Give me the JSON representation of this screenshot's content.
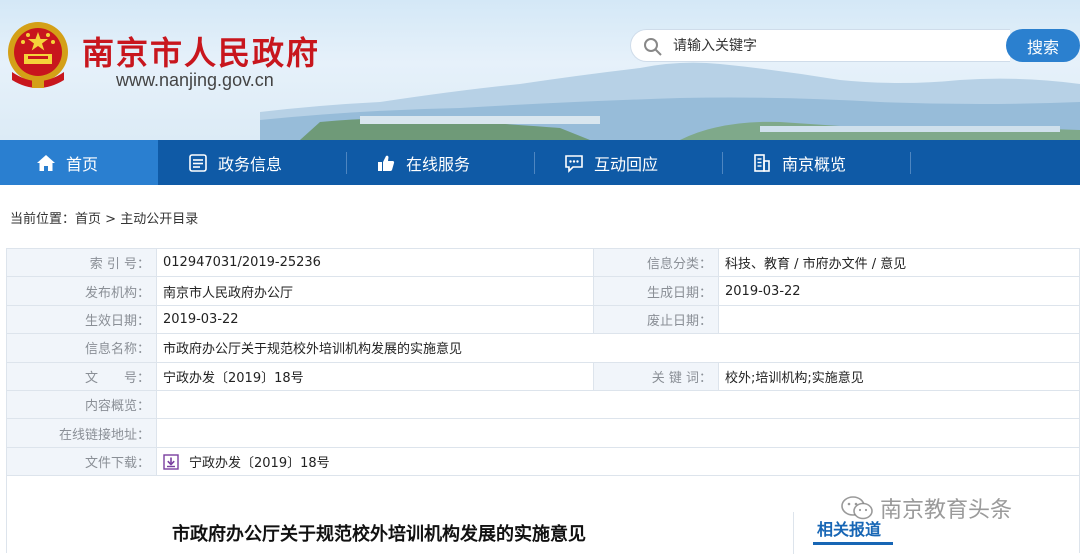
{
  "header": {
    "site_title": "南京市人民政府",
    "site_url": "www.nanjing.gov.cn",
    "search_placeholder": "请输入关键字",
    "search_button": "搜索"
  },
  "nav": {
    "items": [
      {
        "label": "首页",
        "icon": "home-icon"
      },
      {
        "label": "政务信息",
        "icon": "list-icon"
      },
      {
        "label": "在线服务",
        "icon": "thumbs-up-icon"
      },
      {
        "label": "互动回应",
        "icon": "chat-icon"
      },
      {
        "label": "南京概览",
        "icon": "building-icon"
      }
    ]
  },
  "breadcrumb": {
    "prefix": "当前位置：",
    "home": "首页",
    "sep": " > ",
    "current": "主动公开目录"
  },
  "info": {
    "index_label": "索 引 号：",
    "index_value": "012947031/2019-25236",
    "category_label": "信息分类：",
    "category_value": "科技、教育 / 市府办文件 / 意见",
    "publisher_label": "发布机构：",
    "publisher_value": "南京市人民政府办公厅",
    "created_label": "生成日期：",
    "created_value": "2019-03-22",
    "effective_label": "生效日期：",
    "effective_value": "2019-03-22",
    "abolished_label": "废止日期：",
    "abolished_value": "",
    "name_label": "信息名称：",
    "name_value": "市政府办公厅关于规范校外培训机构发展的实施意见",
    "docno_label": "文　　号：",
    "docno_value": "宁政办发〔2019〕18号",
    "keywords_label": "关 键 词：",
    "keywords_value": "校外;培训机构;实施意见",
    "summary_label": "内容概览：",
    "summary_value": "",
    "link_label": "在线链接地址：",
    "link_value": "",
    "download_label": "文件下载：",
    "download_value": "宁政办发〔2019〕18号"
  },
  "article": {
    "title": "市政府办公厅关于规范校外培训机构发展的实施意见",
    "related": "相关报道"
  },
  "watermark": {
    "text": "南京教育头条"
  },
  "colors": {
    "brand_red": "#c8161d",
    "nav_blue": "#0f5aa6",
    "nav_active": "#2a7fd0",
    "link_blue": "#1766b5"
  }
}
